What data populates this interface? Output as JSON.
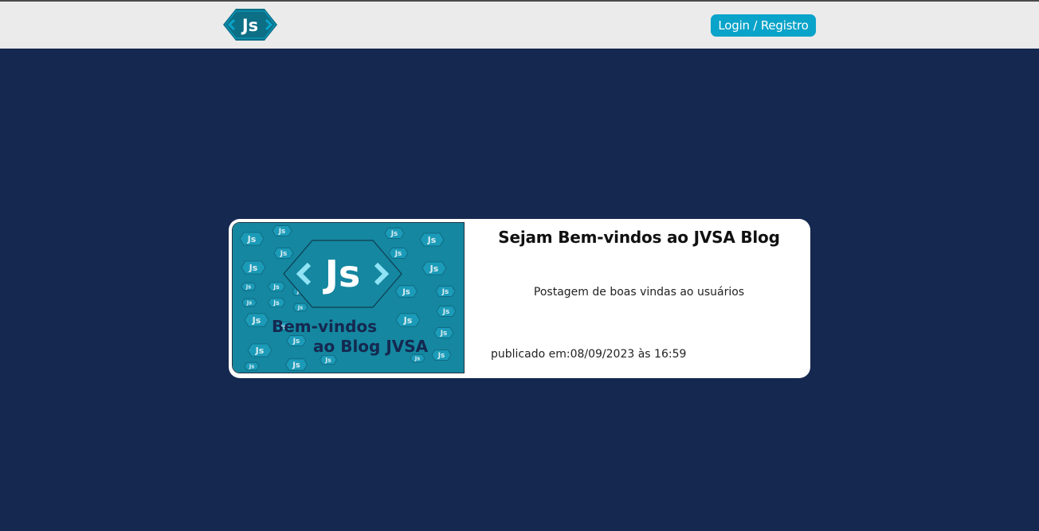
{
  "header": {
    "logo_text": "Js",
    "login_label": "Login / Registro"
  },
  "post": {
    "title": "Sejam Bem-vindos ao JVSA Blog",
    "description": "Postagem de boas vindas ao usuários",
    "published_label": "publicado em:",
    "published_at": "08/09/2023 às 16:59",
    "image": {
      "logo_text": "Js",
      "caption_line1": "Bem-vindos",
      "caption_line2": "ao Blog JVSA"
    }
  },
  "colors": {
    "header_bg": "#ebebeb",
    "page_bg": "#15284f",
    "accent": "#0aa3c9",
    "image_bg": "#1587a0",
    "caption": "#15284f"
  }
}
